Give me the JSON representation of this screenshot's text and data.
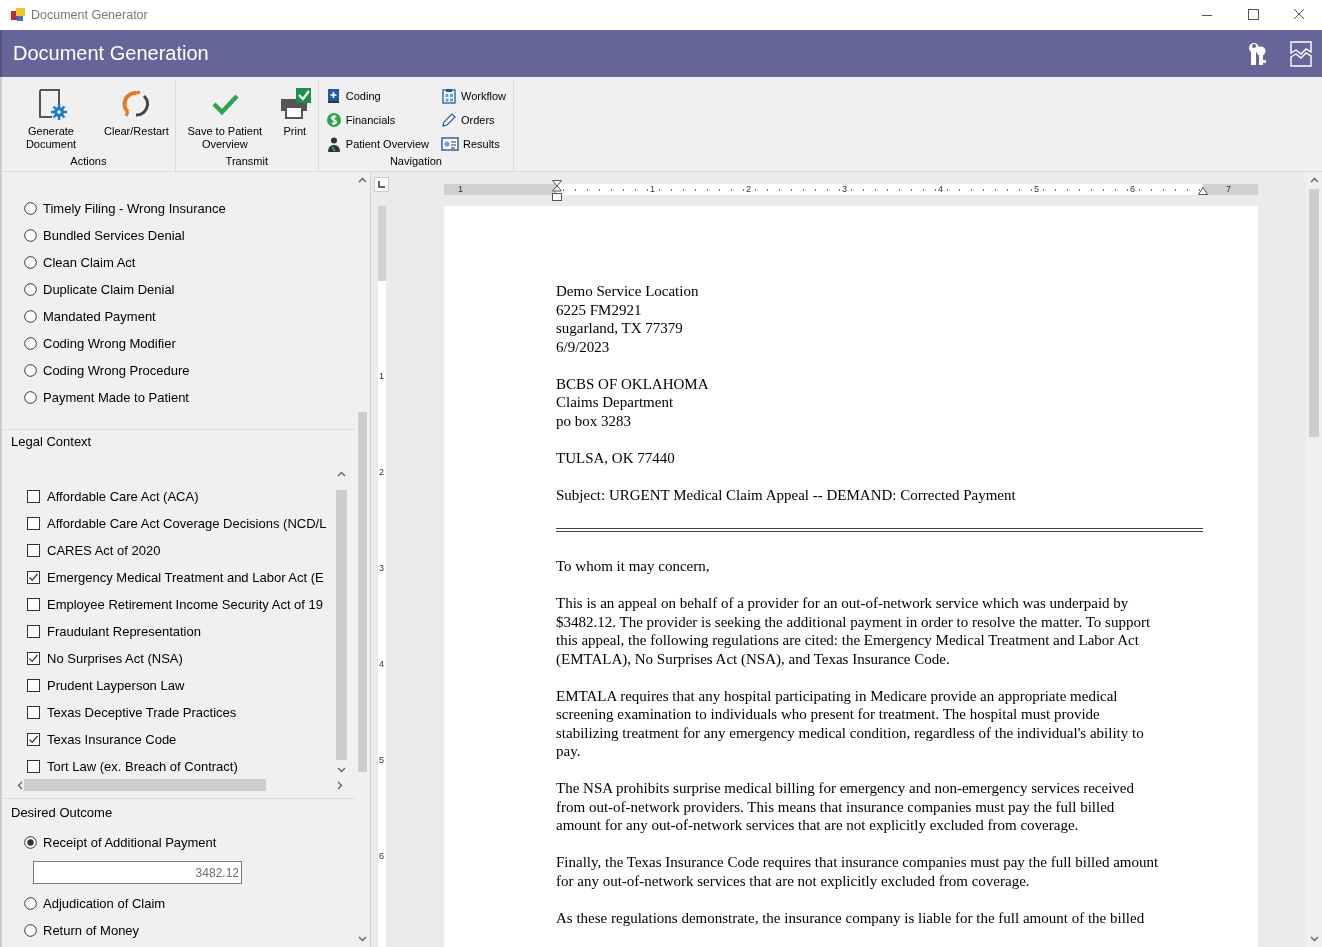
{
  "window": {
    "title": "Document Generator"
  },
  "header": {
    "title": "Document Generation"
  },
  "ribbon": {
    "groups": [
      {
        "label": "Actions",
        "buttons": [
          {
            "label": "Generate Document"
          },
          {
            "label": "Clear/Restart"
          }
        ]
      },
      {
        "label": "Transmit",
        "buttons": [
          {
            "label": "Save to Patient Overview"
          },
          {
            "label": "Print"
          }
        ]
      }
    ],
    "navigation": {
      "label": "Navigation",
      "items": [
        {
          "label": "Coding"
        },
        {
          "label": "Workflow"
        },
        {
          "label": "Financials"
        },
        {
          "label": "Orders"
        },
        {
          "label": "Patient Overview"
        },
        {
          "label": "Results"
        }
      ]
    }
  },
  "reasons": [
    {
      "label": "Timely Filing - Wrong Insurance",
      "selected": false
    },
    {
      "label": "Bundled Services Denial",
      "selected": false
    },
    {
      "label": "Clean Claim Act",
      "selected": false
    },
    {
      "label": "Duplicate Claim Denial",
      "selected": false
    },
    {
      "label": "Mandated Payment",
      "selected": false
    },
    {
      "label": "Coding Wrong Modifier",
      "selected": false
    },
    {
      "label": "Coding Wrong Procedure",
      "selected": false
    },
    {
      "label": "Payment Made to Patient",
      "selected": false
    }
  ],
  "legal_context": {
    "title": "Legal Context",
    "items": [
      {
        "label": "Affordable Care Act (ACA)",
        "checked": false
      },
      {
        "label": "Affordable Care Act Coverage Decisions (NCD/L",
        "checked": false
      },
      {
        "label": "CARES Act of 2020",
        "checked": false
      },
      {
        "label": "Emergency Medical Treatment and Labor Act (E",
        "checked": true
      },
      {
        "label": "Employee Retirement Income Security Act of 19",
        "checked": false
      },
      {
        "label": "Fraudulant Representation",
        "checked": false
      },
      {
        "label": "No Surprises Act (NSA)",
        "checked": true
      },
      {
        "label": "Prudent Layperson Law",
        "checked": false
      },
      {
        "label": "Texas Deceptive Trade Practices",
        "checked": false
      },
      {
        "label": "Texas Insurance Code",
        "checked": true
      },
      {
        "label": "Tort Law (ex. Breach of Contract)",
        "checked": false
      }
    ]
  },
  "desired_outcome": {
    "title": "Desired Outcome",
    "options": [
      {
        "label": "Receipt of Additional Payment",
        "selected": true,
        "amount": "3482.12"
      },
      {
        "label": "Adjudication of Claim",
        "selected": false
      },
      {
        "label": "Return of Money",
        "selected": false
      }
    ]
  },
  "document": {
    "ruler_labels": [
      "1",
      "1",
      "2",
      "3",
      "4",
      "5",
      "6",
      "7"
    ],
    "vertical_ruler_labels": [
      "1",
      "2",
      "3",
      "4",
      "5",
      "6"
    ],
    "blocks": [
      {
        "kind": "paragraph",
        "lines": [
          "Demo Service Location",
          "6225 FM2921",
          "sugarland, TX 77379",
          "6/9/2023"
        ]
      },
      {
        "kind": "paragraph",
        "lines": [
          "BCBS OF OKLAHOMA",
          "Claims Department",
          "po box 3283"
        ]
      },
      {
        "kind": "paragraph",
        "lines": [
          "TULSA, OK 77440"
        ]
      },
      {
        "kind": "paragraph",
        "lines": [
          "Subject: URGENT Medical Claim Appeal -- DEMAND: Corrected Payment"
        ]
      },
      {
        "kind": "rule"
      },
      {
        "kind": "paragraph",
        "lines": [
          "To whom it may concern,"
        ]
      },
      {
        "kind": "paragraph",
        "lines": [
          "This is an appeal on behalf of a provider for an out-of-network service which was underpaid by",
          "$3482.12. The provider is seeking the additional payment in order to resolve the matter. To support",
          "this appeal, the following regulations are cited: the Emergency Medical Treatment and Labor Act",
          "(EMTALA), No Surprises Act (NSA), and Texas Insurance Code."
        ]
      },
      {
        "kind": "paragraph",
        "lines": [
          "EMTALA requires that any hospital participating in Medicare provide an appropriate medical",
          "screening examination to individuals who present for treatment. The hospital must provide",
          "stabilizing treatment for any emergency medical condition, regardless of the individual's ability to",
          "pay."
        ]
      },
      {
        "kind": "paragraph",
        "lines": [
          "The NSA prohibits surprise medical billing for emergency and non-emergency services received",
          "from out-of-network providers. This means that insurance companies must pay the full billed",
          "amount for any out-of-network services that are not explicitly excluded from coverage."
        ]
      },
      {
        "kind": "paragraph",
        "lines": [
          "Finally, the Texas Insurance Code requires that insurance companies must pay the full billed amount",
          "for any out-of-network services that are not explicitly excluded from coverage."
        ]
      },
      {
        "kind": "paragraph",
        "lines": [
          "As these regulations demonstrate, the insurance company is liable for the full amount of the billed"
        ]
      }
    ]
  }
}
